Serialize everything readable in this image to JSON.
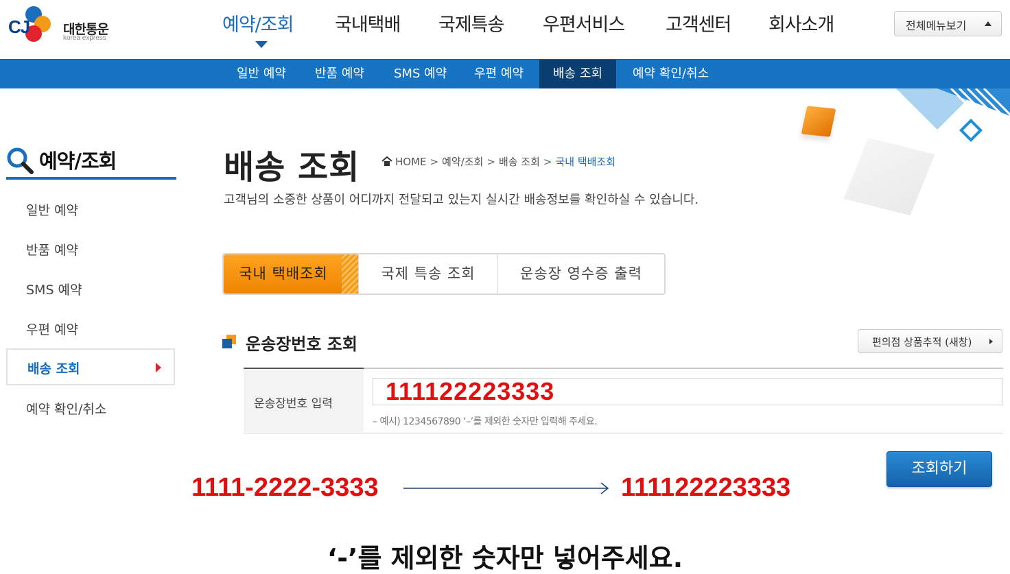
{
  "brand": {
    "logo_text": "CJ",
    "name": "대한통운",
    "sub": "korea express"
  },
  "gnb": {
    "items": [
      "예약/조회",
      "국내택배",
      "국제특송",
      "우편서비스",
      "고객센터",
      "회사소개"
    ],
    "all_menu_label": "전체메뉴보기"
  },
  "subnav": {
    "items": [
      "일반 예약",
      "반품 예약",
      "SMS 예약",
      "우편 예약",
      "배송 조회",
      "예약 확인/취소"
    ]
  },
  "sidebar": {
    "title": "예약/조회",
    "items": [
      "일반 예약",
      "반품 예약",
      "SMS 예약",
      "우편 예약",
      "배송 조회",
      "예약 확인/취소"
    ]
  },
  "page": {
    "title": "배송 조회",
    "breadcrumb": [
      "HOME",
      "예약/조회",
      "배송 조회",
      "국내 택배조회"
    ],
    "description": "고객님의 소중한 상품이 어디까지 전달되고 있는지 실시간 배송정보를 확인하실 수 있습니다."
  },
  "tabs": [
    "국내 택배조회",
    "국제 특송 조회",
    "운송장 영수증 출력"
  ],
  "section": {
    "title": "운송장번호 조회",
    "store_button": "편의점 상품추적 (새창)",
    "field_label": "운송장번호 입력",
    "field_value": "111122223333",
    "hint": "– 예시) 1234567890 ‘–’를 제외한 숫자만 입력해 주세요.",
    "submit_label": "조회하기"
  },
  "annotation": {
    "from": "1111-2222-3333",
    "to": "111122223333",
    "instruction": "‘-’를 제외한 숫자만 넣어주세요."
  },
  "colors": {
    "brand_blue": "#1774c3",
    "active_dark": "#0b3f72",
    "accent_orange": "#f39a18",
    "annotation_red": "#e01010"
  }
}
